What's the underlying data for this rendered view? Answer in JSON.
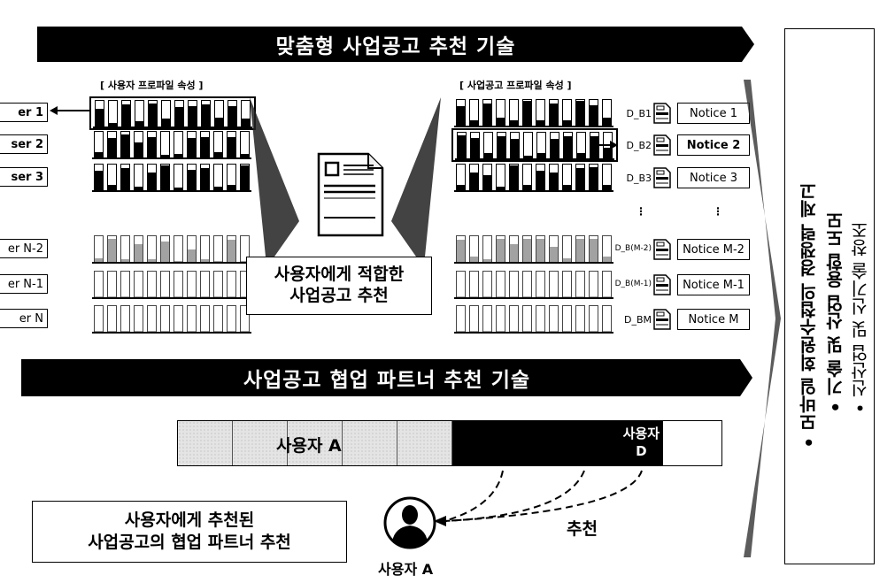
{
  "top_banner": {
    "title": "맞춤형 사업공고 추천 기술"
  },
  "user_profile": {
    "caption": "[ 사용자 프로파일 속성 ]",
    "users": [
      {
        "label": "er 1",
        "highlighted": true,
        "fills": [
          0.7,
          0.15,
          0.85,
          0.2,
          0.9,
          0.3,
          0.75,
          0.8,
          0.85,
          0.35,
          0.8,
          0.3
        ]
      },
      {
        "label": "ser 2",
        "highlighted": false,
        "fills": [
          0.2,
          0.75,
          0.9,
          0.6,
          0.8,
          0.1,
          0.15,
          0.75,
          0.8,
          0.2,
          0.8,
          0.15
        ]
      },
      {
        "label": "ser 3",
        "highlighted": false,
        "fills": [
          0.75,
          0.2,
          0.85,
          0.15,
          0.7,
          0.95,
          0.1,
          0.8,
          0.85,
          0.15,
          0.2,
          0.95
        ]
      },
      {
        "label": "er N-2",
        "highlighted": false,
        "faint": true,
        "fills": [
          0.15,
          0.9,
          0.1,
          0.7,
          0.1,
          0.8,
          0.05,
          0.5,
          0.1,
          0.05,
          0.85,
          0.05
        ]
      },
      {
        "label": "er N-1",
        "highlighted": false,
        "faint": true,
        "fills": [
          0.05,
          0.05,
          0.05,
          0.05,
          0.05,
          0.05,
          0.05,
          0.05,
          0.05,
          0.05,
          0.05,
          0.05
        ]
      },
      {
        "label": "er N",
        "highlighted": false,
        "faint": true,
        "fills": [
          0.05,
          0.05,
          0.05,
          0.05,
          0.05,
          0.05,
          0.05,
          0.05,
          0.05,
          0.05,
          0.05,
          0.05
        ]
      }
    ]
  },
  "center": {
    "line1": "사용자에게 적합한",
    "line2": "사업공고 추천"
  },
  "notice_profile": {
    "caption": "[ 사업공고 프로파일 속성 ]",
    "rows": [
      {
        "doc": "D_B1",
        "notice": "Notice 1",
        "bold": false,
        "highlighted": false,
        "fills": [
          0.75,
          0.2,
          0.85,
          0.3,
          0.2,
          0.95,
          0.2,
          0.85,
          0.2,
          0.95,
          0.8,
          0.3
        ]
      },
      {
        "doc": "D_B2",
        "notice": "Notice 2",
        "bold": true,
        "highlighted": true,
        "fills": [
          0.9,
          0.8,
          0.2,
          0.85,
          0.75,
          0.1,
          0.2,
          0.75,
          0.85,
          0.2,
          0.85,
          0.4
        ]
      },
      {
        "doc": "D_B3",
        "notice": "Notice 3",
        "bold": false,
        "highlighted": false,
        "fills": [
          0.2,
          0.7,
          0.6,
          0.15,
          0.95,
          0.2,
          0.75,
          0.7,
          0.2,
          0.85,
          0.9,
          0.2
        ]
      },
      {
        "doc": "D_B(M-2)",
        "notice": "Notice M-2",
        "bold": false,
        "highlighted": false,
        "faint": true,
        "fills": [
          0.85,
          0.2,
          0.1,
          0.9,
          0.7,
          0.9,
          0.9,
          0.6,
          0.15,
          0.9,
          0.9,
          0.2
        ]
      },
      {
        "doc": "D_B(M-1)",
        "notice": "Notice M-1",
        "bold": false,
        "highlighted": false,
        "faint": true,
        "fills": [
          0.05,
          0.05,
          0.05,
          0.05,
          0.05,
          0.05,
          0.05,
          0.05,
          0.05,
          0.05,
          0.05,
          0.05
        ]
      },
      {
        "doc": "D_BM",
        "notice": "Notice M",
        "bold": false,
        "highlighted": false,
        "faint": true,
        "fills": [
          0.05,
          0.05,
          0.05,
          0.05,
          0.05,
          0.05,
          0.05,
          0.05,
          0.05,
          0.05,
          0.05,
          0.05
        ]
      }
    ],
    "ellipsis": "⋮"
  },
  "mid_banner": {
    "title": "사업공고 협업 파트너 추천 기술"
  },
  "partner_strip": {
    "user_a_label": "사용자 A",
    "user_d_line1": "사용자",
    "user_d_line2": "D"
  },
  "bottom_box": {
    "line1": "사용자에게 추천된",
    "line2": "사업공고의 협업 파트너 추천"
  },
  "recommend_label": "추천",
  "avatar_label": "사용자 A",
  "right_panel": {
    "bullets": [
      "모바일 회원수첩의 경쟁력 제고",
      "기술 및 산업 융합 도모",
      "신산업 및 신기술 창조"
    ],
    "bullet_glyph": "•"
  }
}
